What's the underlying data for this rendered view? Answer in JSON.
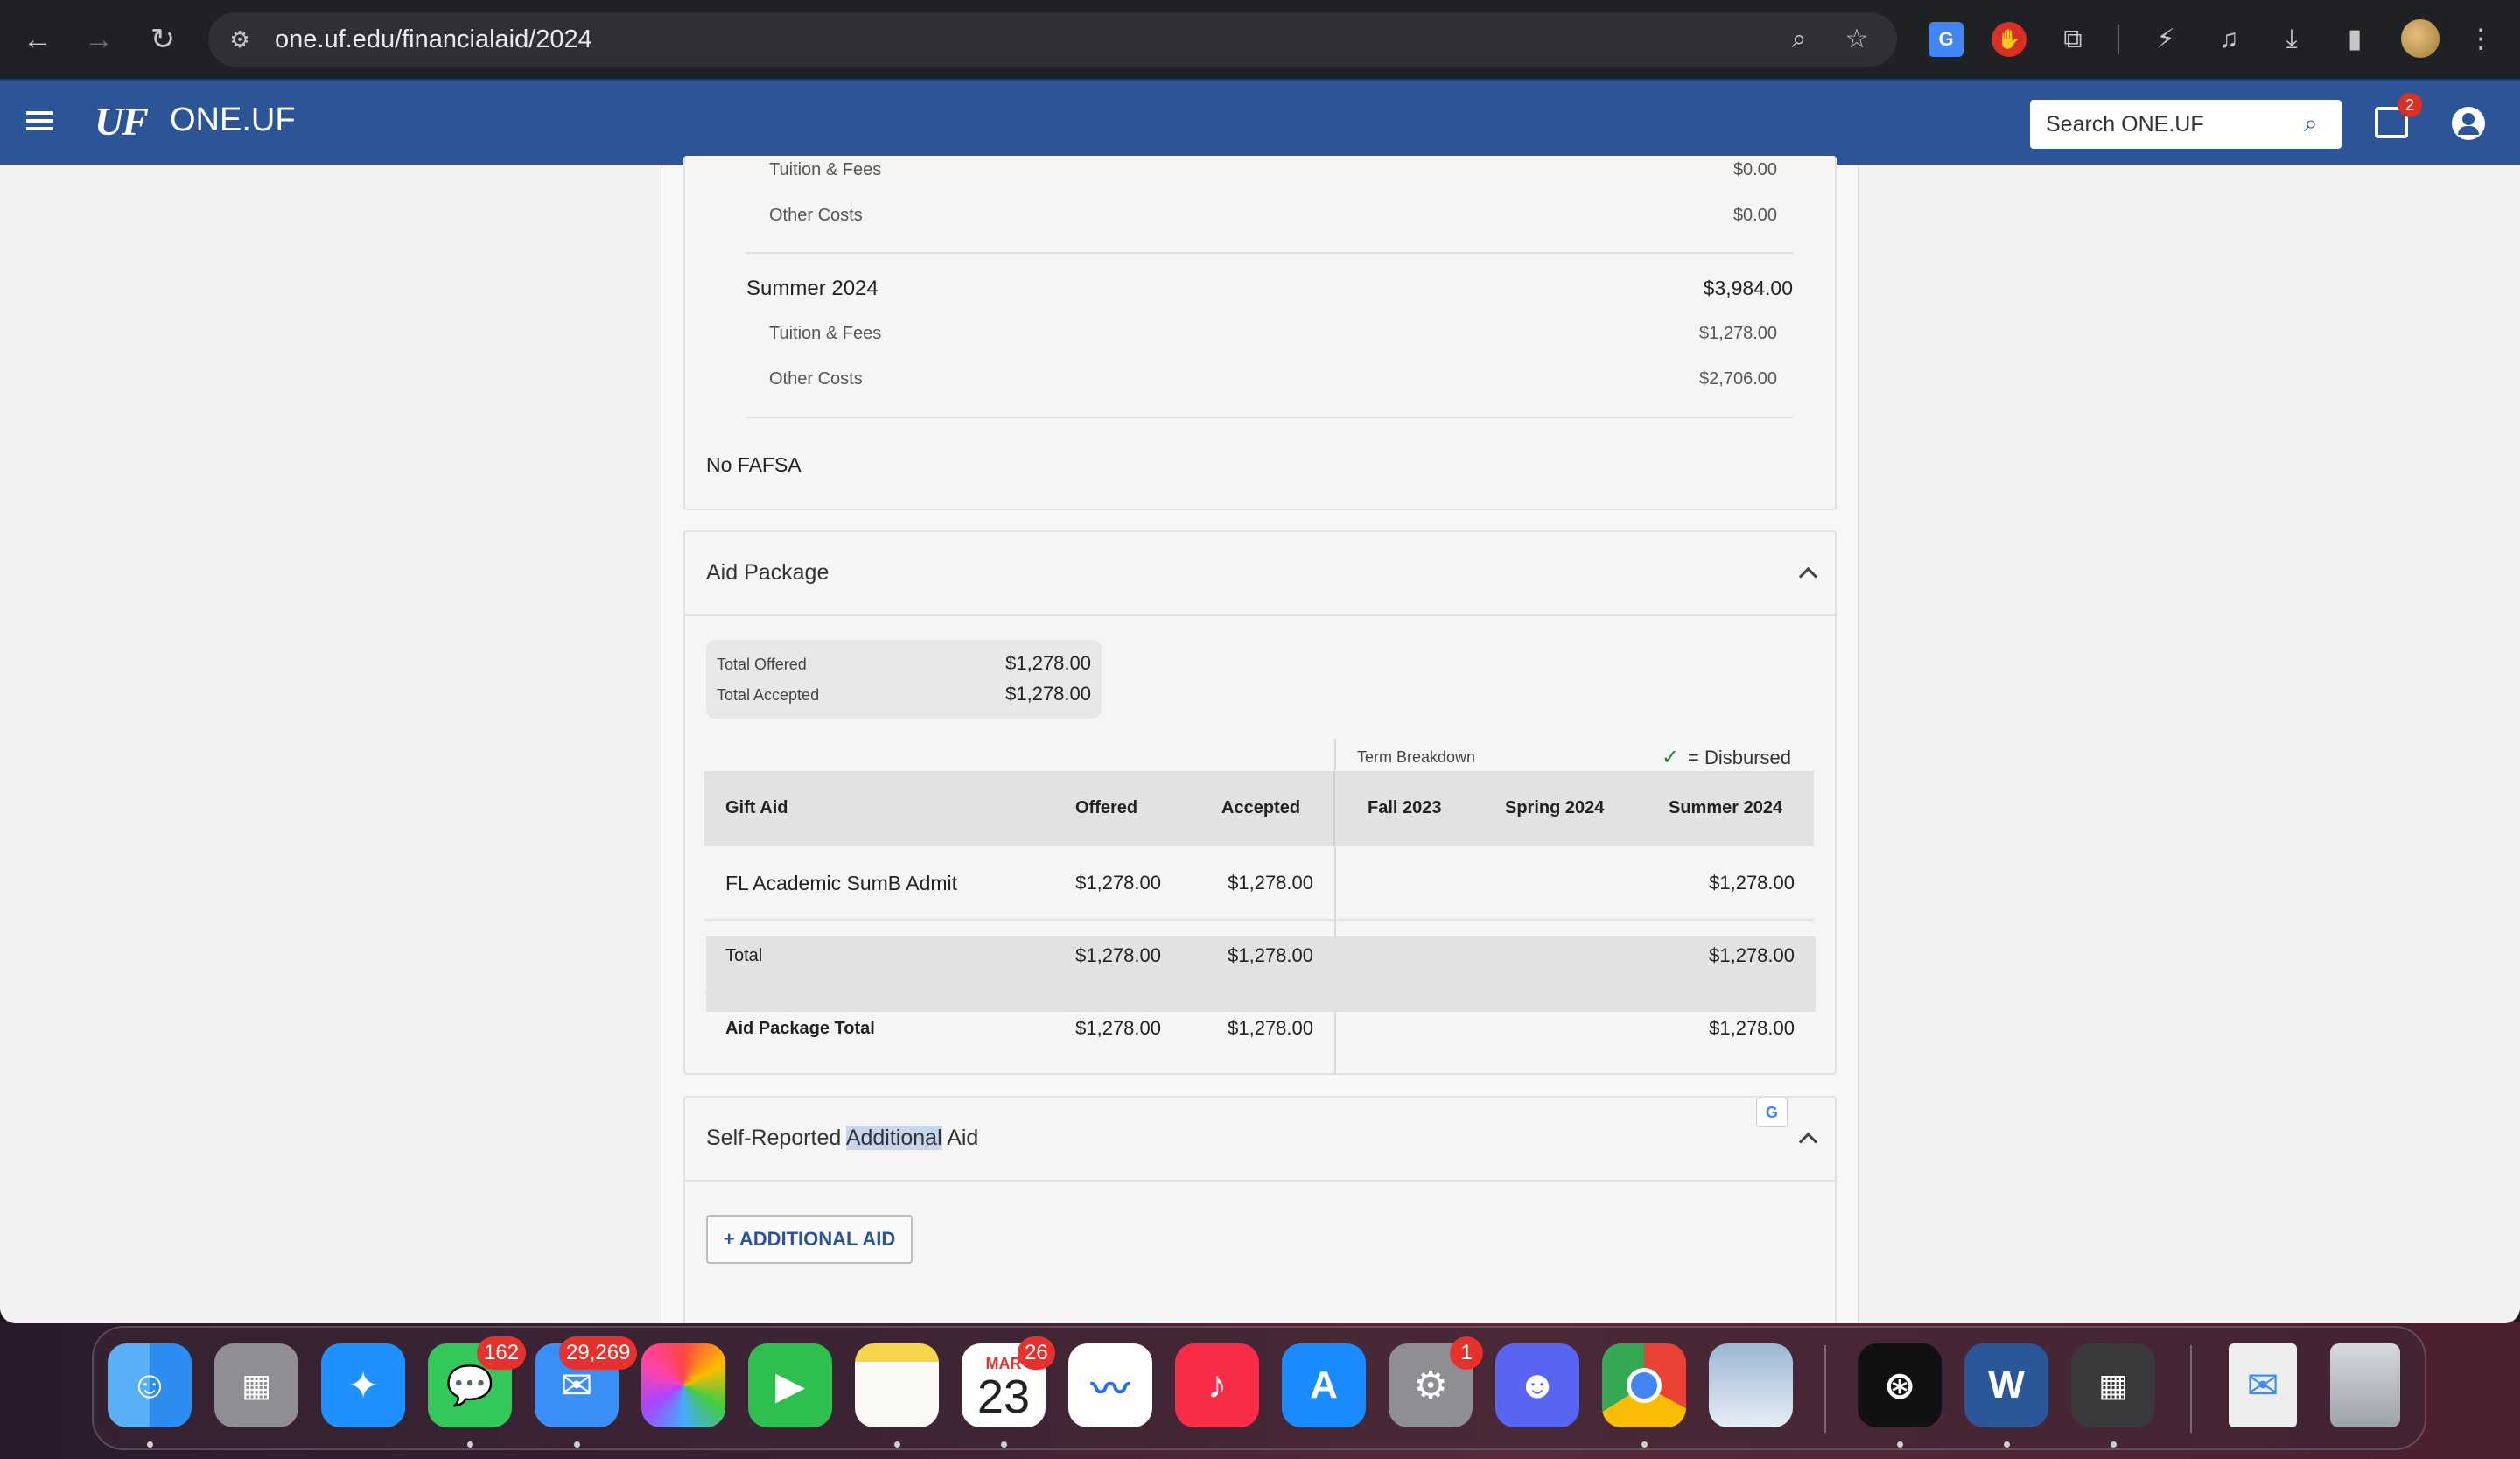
{
  "browser": {
    "url": "one.uf.edu/financialaid/2024"
  },
  "header": {
    "logo": "UF",
    "title": "ONE.UF",
    "search_placeholder": "Search ONE.UF",
    "inbox_badge": "2"
  },
  "costs": {
    "prev_term_rows": [
      {
        "label": "Tuition & Fees",
        "value": "$0.00"
      },
      {
        "label": "Other Costs",
        "value": "$0.00"
      }
    ],
    "summer": {
      "label": "Summer 2024",
      "total": "$3,984.00",
      "rows": [
        {
          "label": "Tuition & Fees",
          "value": "$1,278.00"
        },
        {
          "label": "Other Costs",
          "value": "$2,706.00"
        }
      ]
    },
    "fafsa_status": "No FAFSA"
  },
  "aid_package": {
    "title": "Aid Package",
    "totals": [
      {
        "label": "Total Offered",
        "value": "$1,278.00"
      },
      {
        "label": "Total Accepted",
        "value": "$1,278.00"
      }
    ],
    "term_breakdown_label": "Term Breakdown",
    "disbursed_legend": "= Disbursed",
    "columns": {
      "gift_aid": "Gift Aid",
      "offered": "Offered",
      "accepted": "Accepted",
      "fall": "Fall 2023",
      "spring": "Spring 2024",
      "summer": "Summer 2024"
    },
    "rows": [
      {
        "name": "FL Academic SumB Admit",
        "offered": "$1,278.00",
        "accepted": "$1,278.00",
        "fall": "",
        "spring": "",
        "summer": "$1,278.00"
      },
      {
        "name": "Total",
        "offered": "$1,278.00",
        "accepted": "$1,278.00",
        "fall": "",
        "spring": "",
        "summer": "$1,278.00"
      },
      {
        "name": "Aid Package Total",
        "offered": "$1,278.00",
        "accepted": "$1,278.00",
        "fall": "",
        "spring": "",
        "summer": "$1,278.00"
      }
    ]
  },
  "self_reported": {
    "title_pre": "Self-Reported ",
    "title_highlight": "Additional",
    "title_post": " Aid",
    "add_button": "+ ADDITIONAL AID"
  },
  "dock": {
    "apps": [
      {
        "name": "Finder",
        "color": "#2d8cf0"
      },
      {
        "name": "Launchpad",
        "color": "#8e8e93"
      },
      {
        "name": "Safari",
        "color": "#1e90ff"
      },
      {
        "name": "Messages",
        "color": "#34c759",
        "badge": "162"
      },
      {
        "name": "Mail",
        "color": "#3a8ef5",
        "badge": "29,269"
      },
      {
        "name": "Photos",
        "color": "#f4f4f4"
      },
      {
        "name": "FaceTime",
        "color": "#2fbf4f"
      },
      {
        "name": "Notes",
        "color": "#f7d54a"
      },
      {
        "name": "Calendar",
        "color": "#ffffff",
        "badge": "26",
        "month": "MAR",
        "day": "23"
      },
      {
        "name": "Freeform",
        "color": "#ffffff"
      },
      {
        "name": "Music",
        "color": "#fa2d48"
      },
      {
        "name": "App Store",
        "color": "#1a8cff"
      },
      {
        "name": "System Settings",
        "color": "#8e8e93",
        "badge": "1"
      },
      {
        "name": "Discord",
        "color": "#5865f2"
      },
      {
        "name": "Chrome",
        "color": "#ffffff"
      },
      {
        "name": "Preview",
        "color": "#9bb7d4"
      },
      {
        "name": "ChatGPT",
        "color": "#111111"
      },
      {
        "name": "Word",
        "color": "#2b579a"
      },
      {
        "name": "Calculator",
        "color": "#3a3a3c"
      },
      {
        "name": "EML File",
        "color": "#eeeeee"
      },
      {
        "name": "Trash",
        "color": "#bfc3c9"
      }
    ]
  }
}
